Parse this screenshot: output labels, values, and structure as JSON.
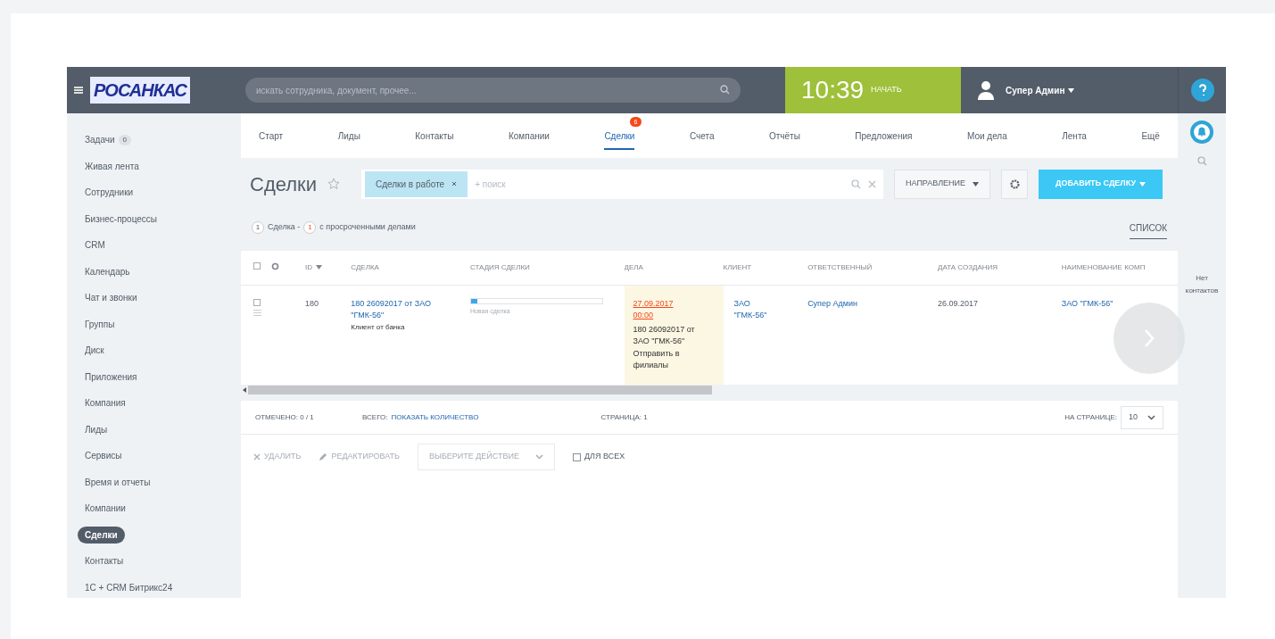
{
  "header": {
    "logo_text": "РОСАНКАС",
    "search": {
      "placeholder": "искать сотрудника, документ, прочее..."
    },
    "clock": {
      "time": "10:39",
      "action": "НАЧАТЬ"
    },
    "user": {
      "name": "Супер Админ"
    }
  },
  "sidebar": {
    "items": [
      {
        "label": "Задачи",
        "counter": "0",
        "selected": false
      },
      {
        "label": "Живая лента",
        "selected": false
      },
      {
        "label": "Сотрудники",
        "selected": false
      },
      {
        "label": "Бизнес-процессы",
        "selected": false
      },
      {
        "label": "CRM",
        "selected": false
      },
      {
        "label": "Календарь",
        "selected": false
      },
      {
        "label": "Чат и звонки",
        "selected": false
      },
      {
        "label": "Группы",
        "selected": false
      },
      {
        "label": "Диск",
        "selected": false
      },
      {
        "label": "Приложения",
        "selected": false
      },
      {
        "label": "Компания",
        "selected": false
      },
      {
        "label": "Лиды",
        "selected": false
      },
      {
        "label": "Сервисы",
        "selected": false
      },
      {
        "label": "Время и отчеты",
        "selected": false
      },
      {
        "label": "Компании",
        "selected": false
      },
      {
        "label": "Сделки",
        "selected": true
      },
      {
        "label": "Контакты",
        "selected": false
      },
      {
        "label": "1С + CRM Битрикс24",
        "selected": false
      }
    ]
  },
  "tabs": [
    {
      "label": "Старт",
      "selected": false
    },
    {
      "label": "Лиды",
      "selected": false
    },
    {
      "label": "Контакты",
      "selected": false
    },
    {
      "label": "Компании",
      "selected": false
    },
    {
      "label": "Сделки",
      "selected": true,
      "badge": "6"
    },
    {
      "label": "Счета",
      "selected": false
    },
    {
      "label": "Отчёты",
      "selected": false
    },
    {
      "label": "Предложения",
      "selected": false
    },
    {
      "label": "Мои дела",
      "selected": false
    },
    {
      "label": "Лента",
      "selected": false
    },
    {
      "label": "Ещё",
      "selected": false
    }
  ],
  "page_title": "Сделки",
  "filter": {
    "chip": "Сделки в работе",
    "placeholder": "+ поиск"
  },
  "direction_button": "НАПРАВЛЕНИЕ",
  "add_button": "ДОБАВИТЬ СДЕЛКУ",
  "counters": {
    "count_1": "1",
    "text_1": "Сделка -",
    "count_2": "1",
    "text_2": "с просроченными делами"
  },
  "view_tab": "СПИСОК",
  "table": {
    "columns": [
      "ID",
      "СДЕЛКА",
      "СТАДИЯ СДЕЛКИ",
      "ДЕЛА",
      "КЛИЕНТ",
      "ОТВЕТСТВЕННЫЙ",
      "ДАТА СОЗДАНИЯ",
      "НАИМЕНОВАНИЕ КОМП"
    ],
    "all_checked": false,
    "rows": [
      {
        "checked": false,
        "id": "180",
        "deal": "180 26092017 от ЗАО \"ГМК-56\"",
        "deal_note": "Клиент от банка",
        "stage": "Новая сделка",
        "level": 0.05,
        "activity_date": "27.09.2017 00:00",
        "activity": "180 26092017 от ЗАО \"ГМК-56\" Отправить в филиалы",
        "client": "ЗАО \"ГМК-56\"",
        "responsible": "Супер Админ",
        "created": "26.09.2017",
        "company": "ЗАО \"ГМК-56\""
      }
    ]
  },
  "footer": {
    "selected": "ОТМЕЧЕНО: 0 / 1",
    "total_label": "ВСЕГО:",
    "total_link": "ПОКАЗАТЬ КОЛИЧЕСТВО",
    "page": "СТРАНИЦА: 1",
    "per_page_label": "НА СТРАНИЦЕ:",
    "per_page": "10"
  },
  "actions": {
    "delete": "УДАЛИТЬ",
    "edit": "РЕДАКТИРОВАТЬ",
    "select": "ВЫБЕРИТЕ ДЕЙСТВИЕ",
    "for_all": "ДЛЯ ВСЕХ",
    "for_all_checked": false
  },
  "right_panel": {
    "empty_text": "Нет контактов"
  }
}
